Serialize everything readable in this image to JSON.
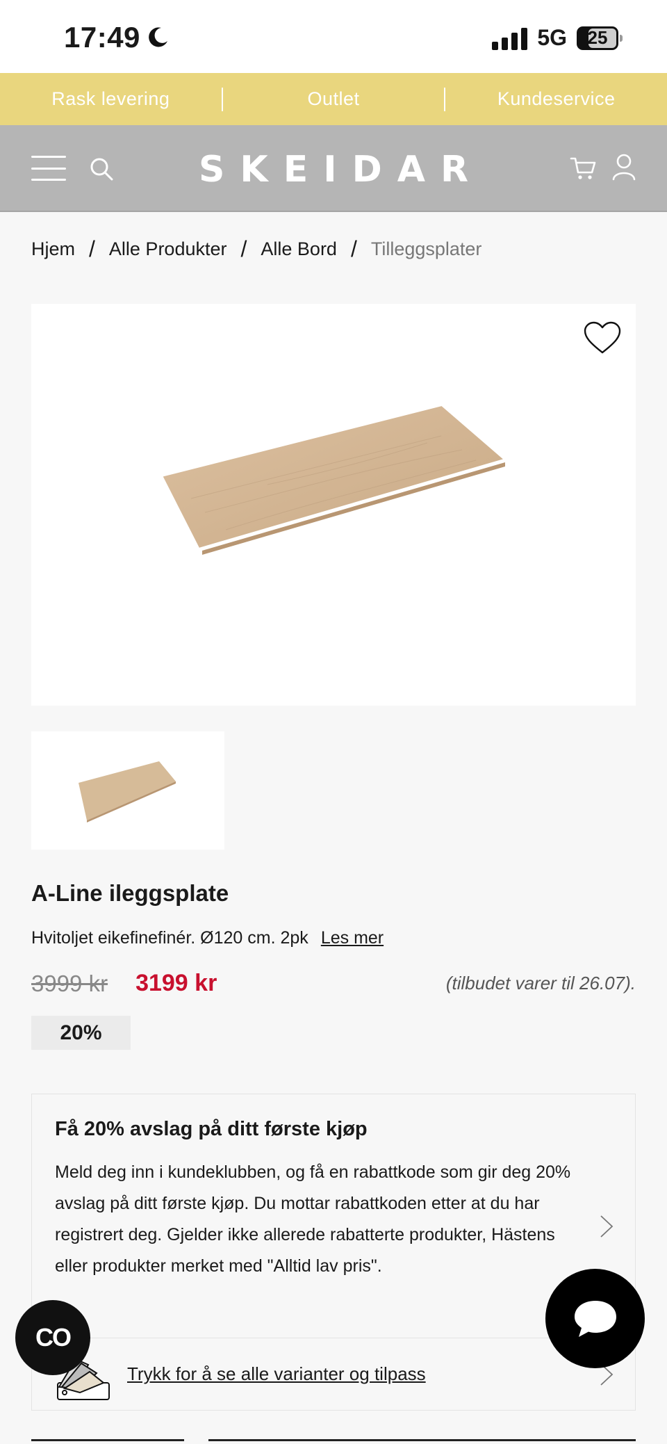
{
  "status_bar": {
    "time": "17:49",
    "network": "5G",
    "battery": "25"
  },
  "promo_bar": {
    "items": [
      "Rask levering",
      "Outlet",
      "Kundeservice"
    ]
  },
  "header": {
    "logo": "SKEIDAR"
  },
  "breadcrumb": {
    "items": [
      "Hjem",
      "Alle Produkter",
      "Alle Bord"
    ],
    "current": "Tilleggsplater",
    "separator": "/"
  },
  "product": {
    "title": "A-Line ileggsplate",
    "description": "Hvitoljet eikefinefinér. Ø120 cm. 2pk",
    "read_more": "Les mer",
    "old_price": "3999 kr",
    "new_price": "3199 kr",
    "offer_note": "(tilbudet varer til 26.07).",
    "discount": "20%"
  },
  "club": {
    "title": "Få 20% avslag på ditt første kjøp",
    "text": "Meld deg inn i kundeklubben, og få en rabattkode som gir deg 20% avslag på ditt første kjøp. Du mottar rabattkoden etter at du har registrert deg. Gjelder ikke allerede rabatterte produkter, Hästens eller produkter merket med \"Alltid lav pris\"."
  },
  "variants": {
    "link": "Trykk for å se alle varianter og tilpass"
  },
  "co_button": {
    "label": "CO"
  },
  "colors": {
    "promo_bg": "#e9d67e",
    "header_bg": "#b5b5b5",
    "sale_red": "#c8102e"
  }
}
